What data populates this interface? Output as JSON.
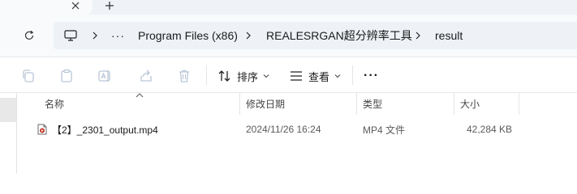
{
  "window": {
    "new_tab_glyph": "+",
    "close_glyph": "×"
  },
  "address": {
    "refresh_icon": "refresh-icon",
    "computer_icon": "computer-icon",
    "overflow": "···",
    "segments": [
      "Program Files (x86)",
      "REALESRGAN超分辨率工具",
      "result"
    ]
  },
  "toolbar": {
    "sort_label": "排序",
    "view_label": "查看",
    "more_label": "···"
  },
  "columns": {
    "name": "名称",
    "modified": "修改日期",
    "type": "类型",
    "size": "大小"
  },
  "files": [
    {
      "name": "【2】_2301_output.mp4",
      "modified": "2024/11/26 16:24",
      "type": "MP4 文件",
      "size": "42,284 KB",
      "icon": "video-file-icon"
    }
  ],
  "colors": {
    "accent": "#005fb8",
    "disabled_icon": "#b9c6d6",
    "address_bg": "#eef2f7"
  }
}
